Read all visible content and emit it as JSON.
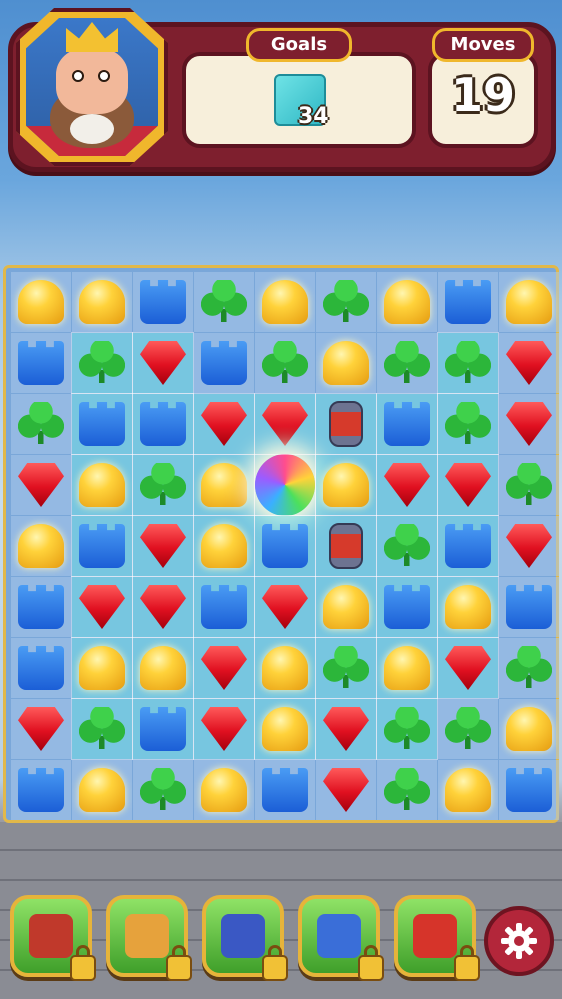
{
  "hud": {
    "goals_label": "Goals",
    "moves_label": "Moves",
    "goal_count": "34",
    "goal_target": "ice-tile-icon",
    "moves_remaining": "19"
  },
  "board": {
    "rows": 9,
    "cols": 9,
    "pieces": [
      [
        "yellow",
        "yellow",
        "blue",
        "green",
        "yellow",
        "green",
        "yellow",
        "blue",
        "yellow"
      ],
      [
        "blue",
        "green",
        "red",
        "blue",
        "green",
        "yellow",
        "green",
        "green",
        "red"
      ],
      [
        "green",
        "blue",
        "blue",
        "red",
        "red",
        "barrel",
        "blue",
        "green",
        "red"
      ],
      [
        "red",
        "yellow",
        "green",
        "yellow",
        "disco",
        "yellow",
        "red",
        "red",
        "green"
      ],
      [
        "yellow",
        "blue",
        "red",
        "yellow",
        "blue",
        "barrel",
        "green",
        "blue",
        "red"
      ],
      [
        "blue",
        "red",
        "red",
        "blue",
        "red",
        "yellow",
        "blue",
        "yellow",
        "blue"
      ],
      [
        "blue",
        "yellow",
        "yellow",
        "red",
        "yellow",
        "green",
        "yellow",
        "red",
        "green"
      ],
      [
        "red",
        "green",
        "blue",
        "red",
        "yellow",
        "red",
        "green",
        "green",
        "yellow"
      ],
      [
        "blue",
        "yellow",
        "green",
        "yellow",
        "blue",
        "red",
        "green",
        "yellow",
        "blue"
      ]
    ],
    "ice": [
      [
        0,
        0,
        0,
        0,
        0,
        0,
        0,
        0,
        0
      ],
      [
        0,
        1,
        1,
        0,
        0,
        0,
        0,
        1,
        0
      ],
      [
        0,
        1,
        1,
        1,
        1,
        1,
        1,
        1,
        0
      ],
      [
        0,
        1,
        1,
        1,
        1,
        1,
        1,
        1,
        0
      ],
      [
        0,
        1,
        1,
        1,
        1,
        1,
        1,
        1,
        0
      ],
      [
        0,
        1,
        1,
        1,
        1,
        1,
        1,
        1,
        0
      ],
      [
        0,
        1,
        1,
        1,
        1,
        1,
        1,
        1,
        0
      ],
      [
        0,
        1,
        1,
        1,
        1,
        1,
        1,
        0,
        0
      ],
      [
        0,
        0,
        0,
        0,
        0,
        0,
        0,
        0,
        0
      ]
    ]
  },
  "boosters": [
    {
      "name": "hammer-icon",
      "color": "#c0392b",
      "locked": true
    },
    {
      "name": "cannon-icon",
      "color": "#e6a23c",
      "locked": true
    },
    {
      "name": "rocket-icon",
      "color": "#3a58c4",
      "locked": true
    },
    {
      "name": "wizard-hat-icon",
      "color": "#3a6ed8",
      "locked": true
    },
    {
      "name": "airplane-icon",
      "color": "#d6342a",
      "locked": true
    }
  ],
  "colors": {
    "hud_frame": "#7e1f2e",
    "hud_gold": "#f0b72c",
    "booster_green": "#5fc24a",
    "settings_red": "#b3263a"
  }
}
